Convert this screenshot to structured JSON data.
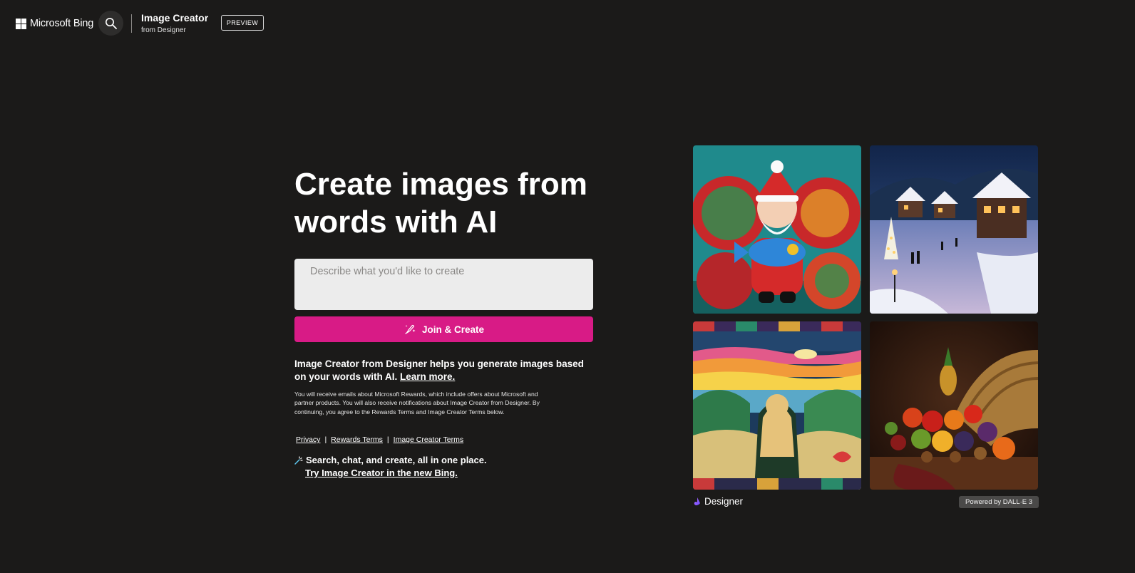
{
  "header": {
    "logo_text": "Microsoft Bing",
    "search_icon": "search-icon",
    "brand_title": "Image Creator",
    "brand_subtitle": "from Designer",
    "preview_label": "PREVIEW"
  },
  "hero": {
    "title": "Create images from words with AI",
    "prompt_placeholder": "Describe what you'd like to create",
    "prompt_value": "",
    "join_button_label": "Join & Create",
    "join_button_icon": "brush-sparkle-icon",
    "accent_color": "#d81b86"
  },
  "description": {
    "text": "Image Creator from Designer helps you generate images based on your words with AI.",
    "learn_more": "Learn more."
  },
  "fine_print": "You will receive emails about Microsoft Rewards, which include offers about Microsoft and partner products. You will also receive notifications about Image Creator from Designer. By continuing, you agree to the Rewards Terms and Image Creator Terms below.",
  "legal_links": {
    "privacy": "Privacy",
    "sep": "|",
    "rewards_terms": "Rewards Terms",
    "image_creator_terms": "Image Creator Terms"
  },
  "promo": {
    "icon": "sparkle-icon",
    "line1": "Search, chat, and create, all in one place.",
    "link": "Try Image Creator in the new Bing."
  },
  "gallery": {
    "designer_label": "Designer",
    "designer_icon": "designer-logo-icon",
    "powered_by": "Powered by DALL·E 3"
  }
}
